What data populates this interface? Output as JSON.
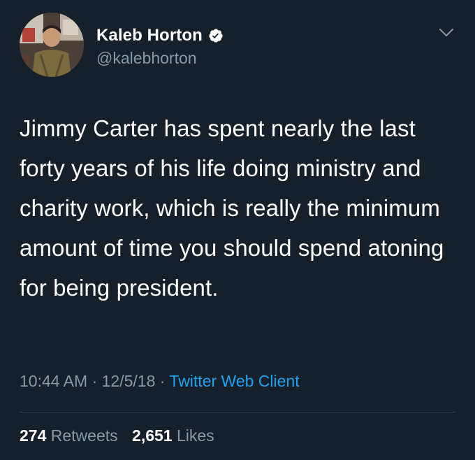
{
  "author": {
    "display_name": "Kaleb Horton",
    "handle": "@kalebhorton",
    "verified": true
  },
  "tweet": {
    "text": "Jimmy Carter has spent nearly the last forty years of his life doing ministry and charity work, which is really the minimum amount of time you should spend atoning for being president."
  },
  "meta": {
    "time": "10:44 AM",
    "date": "12/5/18",
    "separator": " · ",
    "source": "Twitter Web Client"
  },
  "stats": {
    "retweets_count": "274",
    "retweets_label": "Retweets",
    "likes_count": "2,651",
    "likes_label": "Likes"
  },
  "icons": {
    "verified": "verified-badge-icon",
    "menu": "chevron-down-icon"
  },
  "colors": {
    "background": "#15202b",
    "text_primary": "#ffffff",
    "text_secondary": "#8899a6",
    "link": "#1da1f2",
    "divider": "#38444d"
  }
}
